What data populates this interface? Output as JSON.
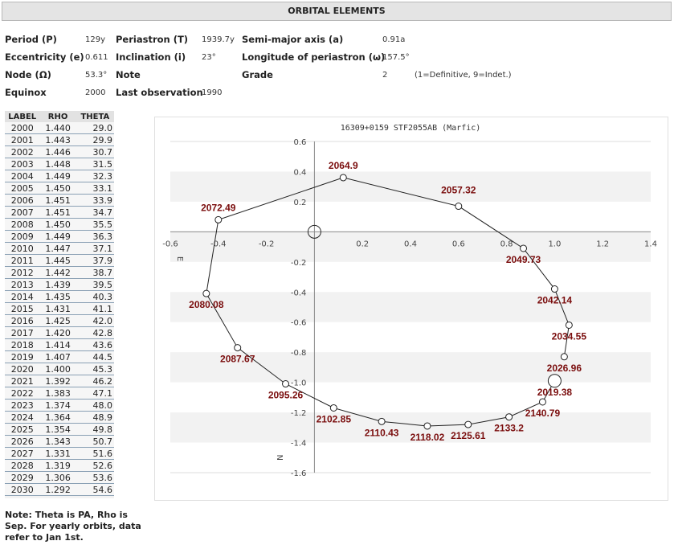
{
  "header": {
    "title": "ORBITAL ELEMENTS"
  },
  "elements": {
    "period_label": "Period (P)",
    "period_value": "129y",
    "periastron_label": "Periastron (T)",
    "periastron_value": "1939.7y",
    "semimajor_label": "Semi-major axis (a)",
    "semimajor_value": "0.91a",
    "eccentricity_label": "Eccentricity (e)",
    "eccentricity_value": "0.611",
    "inclination_label": "Inclination (i)",
    "inclination_value": "23°",
    "longitude_label": "Longitude of periastron (ω)",
    "longitude_value": "157.5°",
    "node_label": "Node (Ω)",
    "node_value": "53.3°",
    "note_label": "Note",
    "grade_label": "Grade",
    "grade_value": "2",
    "grade_legend": "(1=Definitive, 9=Indet.)",
    "equinox_label": "Equinox",
    "equinox_value": "2000",
    "lastobs_label": "Last observation",
    "lastobs_value": "1990"
  },
  "ephemeris": {
    "headers": [
      "LABEL",
      "RHO",
      "THETA"
    ],
    "rows": [
      [
        "2000",
        "1.440",
        "29.0"
      ],
      [
        "2001",
        "1.443",
        "29.9"
      ],
      [
        "2002",
        "1.446",
        "30.7"
      ],
      [
        "2003",
        "1.448",
        "31.5"
      ],
      [
        "2004",
        "1.449",
        "32.3"
      ],
      [
        "2005",
        "1.450",
        "33.1"
      ],
      [
        "2006",
        "1.451",
        "33.9"
      ],
      [
        "2007",
        "1.451",
        "34.7"
      ],
      [
        "2008",
        "1.450",
        "35.5"
      ],
      [
        "2009",
        "1.449",
        "36.3"
      ],
      [
        "2010",
        "1.447",
        "37.1"
      ],
      [
        "2011",
        "1.445",
        "37.9"
      ],
      [
        "2012",
        "1.442",
        "38.7"
      ],
      [
        "2013",
        "1.439",
        "39.5"
      ],
      [
        "2014",
        "1.435",
        "40.3"
      ],
      [
        "2015",
        "1.431",
        "41.1"
      ],
      [
        "2016",
        "1.425",
        "42.0"
      ],
      [
        "2017",
        "1.420",
        "42.8"
      ],
      [
        "2018",
        "1.414",
        "43.6"
      ],
      [
        "2019",
        "1.407",
        "44.5"
      ],
      [
        "2020",
        "1.400",
        "45.3"
      ],
      [
        "2021",
        "1.392",
        "46.2"
      ],
      [
        "2022",
        "1.383",
        "47.1"
      ],
      [
        "2023",
        "1.374",
        "48.0"
      ],
      [
        "2024",
        "1.364",
        "48.9"
      ],
      [
        "2025",
        "1.354",
        "49.8"
      ],
      [
        "2026",
        "1.343",
        "50.7"
      ],
      [
        "2027",
        "1.331",
        "51.6"
      ],
      [
        "2028",
        "1.319",
        "52.6"
      ],
      [
        "2029",
        "1.306",
        "53.6"
      ],
      [
        "2030",
        "1.292",
        "54.6"
      ]
    ]
  },
  "note": {
    "text": "Note: Theta is PA, Rho is Sep. For yearly orbits, data refer to Jan 1st."
  },
  "chart_data": {
    "type": "scatter",
    "title": "16309+0159 STF2055AB (Marfic)",
    "xlim": [
      -0.6,
      1.4
    ],
    "ylim": [
      -1.6,
      0.6
    ],
    "xticks": [
      -0.6,
      -0.4,
      -0.2,
      0.2,
      0.4,
      0.6,
      0.8,
      1.0,
      1.2,
      1.4
    ],
    "xtick_labels": [
      "-0.6",
      "-0.4",
      "-0.2",
      "0.2",
      "0.4",
      "0.6",
      "0.8",
      "1.0",
      "1.2",
      "1.4"
    ],
    "yticks": [
      0.6,
      0.4,
      0.2,
      -0.2,
      -0.4,
      -0.6,
      -0.8,
      -1.0,
      -1.2,
      -1.4,
      -1.6
    ],
    "ytick_labels": [
      "0.6",
      "0.4",
      "0.2",
      "-0.2",
      "-0.4",
      "-0.6",
      "-0.8",
      "-1.0",
      "-1.2",
      "-1.4",
      "-1.6"
    ],
    "axis_label_east": "E",
    "axis_label_north": "N",
    "grid": "alternating horizontal bands",
    "primary": {
      "x": 0,
      "y": 0
    },
    "current_position": {
      "x": 1.0,
      "y": -0.99
    },
    "orbit_points": [
      {
        "x": 1.04,
        "y": -0.83,
        "label": "2026.96"
      },
      {
        "x": 1.06,
        "y": -0.62,
        "label": "2034.55"
      },
      {
        "x": 1.0,
        "y": -0.38,
        "label": "2042.14"
      },
      {
        "x": 0.87,
        "y": -0.11,
        "label": "2049.73"
      },
      {
        "x": 0.6,
        "y": 0.17,
        "label": "2057.32"
      },
      {
        "x": 0.12,
        "y": 0.36,
        "label": "2064.9"
      },
      {
        "x": -0.4,
        "y": 0.08,
        "label": "2072.49"
      },
      {
        "x": -0.45,
        "y": -0.41,
        "label": "2080.08"
      },
      {
        "x": -0.32,
        "y": -0.77,
        "label": "2087.67"
      },
      {
        "x": -0.12,
        "y": -1.01,
        "label": "2095.26"
      },
      {
        "x": 0.08,
        "y": -1.17,
        "label": "2102.85"
      },
      {
        "x": 0.28,
        "y": -1.26,
        "label": "2110.43"
      },
      {
        "x": 0.47,
        "y": -1.29,
        "label": "2118.02"
      },
      {
        "x": 0.64,
        "y": -1.28,
        "label": "2125.61"
      },
      {
        "x": 0.81,
        "y": -1.23,
        "label": "2133.2"
      },
      {
        "x": 0.95,
        "y": -1.13,
        "label": "2140.79"
      },
      {
        "x": 1.0,
        "y": -0.99,
        "label": "2019.38"
      }
    ]
  }
}
